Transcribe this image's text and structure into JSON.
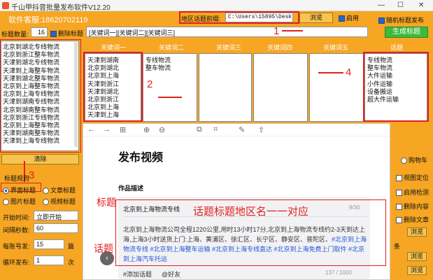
{
  "window": {
    "title": "千山甲抖音批量发布软件V12.20",
    "minimize": "—",
    "maximize": "☐",
    "close": "✕"
  },
  "header": {
    "app_name": "软件客服:18620702119",
    "region_label": "地区话题前缀:",
    "region_path": "C:\\Users\\15895\\Desktop",
    "browse": "浏览",
    "enable": "启用",
    "random_post": "随机标题发布"
  },
  "title_row": {
    "count_label": "标题数量:",
    "count": "16",
    "delete_title": "删除标题",
    "keywords": "[关键词一][关键词二][关键词三]",
    "generate": "生成标题"
  },
  "left_list": {
    "items": [
      "北京到湖北专线物流",
      "北京到浙江整车物流",
      "天津到湖北专线物流",
      "天津到上海整车物流",
      "天津到湖北整车物流",
      "北京到上海整车物流",
      "北京到上海专线物流",
      "天津到湖南专线物流",
      "北京到湖南整车物流",
      "北京到浙江专线物流",
      "北京到上海整车物流",
      "天津到湖南整车物流",
      "天津到上海专线物流"
    ],
    "clear": "清除"
  },
  "columns": {
    "headers": [
      "关键词一",
      "关键词二",
      "关键词三",
      "关键词四",
      "关键词五",
      "话题"
    ],
    "kw1": [
      "天津到湖南",
      "北京到湖北",
      "北京到上海",
      "天津到浙江",
      "天津到湖北",
      "北京到浙江",
      "北京到上海",
      "天津到上海"
    ],
    "kw2": [
      "专线物流",
      "整车物流"
    ],
    "topics": [
      "专线物流",
      "整车物流",
      "大件运输",
      "小件运输",
      "设备搬运",
      "超大件运输"
    ]
  },
  "annotations": {
    "a1": "1",
    "a2": "2",
    "a3": "3",
    "a4": "4",
    "biaoti": "标题",
    "huati": "话题",
    "note": "话题标题地区名一一对应"
  },
  "left_controls": {
    "rule_label": "标题规则",
    "r_ui": "界面标题",
    "r_file": "文章标题",
    "r_img": "图片标题",
    "r_video": "视频标题",
    "start_label": "开始时间:",
    "start_val": "立即开始",
    "interval_label": "间隔秒数:",
    "interval_val": "60",
    "perday_label": "每账号发:",
    "perday_val": "15",
    "perday_unit": "篇",
    "loop_label": "循环发布:",
    "loop_val": "1",
    "loop_unit": "次"
  },
  "right_controls": {
    "cart": "购物车",
    "video_pos": "视图定位",
    "enable_detect": "启用检测",
    "delete_content": "删除内容",
    "delete_article": "删除文章",
    "browse": "浏览",
    "x_suffix": "条"
  },
  "browser": {
    "heading": "发布视频",
    "desc_label": "作品描述",
    "title_text": "北京到上海物流专线",
    "counter_title": "9/30",
    "body": "北京到上海物流公司全程1220公里,用时13小时17分,北京到上海物流专线约2-3天到达上海,上海3小时送货上门:上海、黄浦区、徐汇区、长宁区、静安区、普陀区、",
    "tags": "#北京到上海物流专线 #北京到上海整车运输 #北京到上海专线直达 #北京到上海免费上门取件 #北京到上海汽车托运",
    "add_topic": "#添加话题",
    "at_friend": "@好友",
    "counter_body": "137 / 1000"
  },
  "colors": {
    "accent": "#f6a623",
    "annotation": "#e02020",
    "tag": "#2355d8"
  }
}
